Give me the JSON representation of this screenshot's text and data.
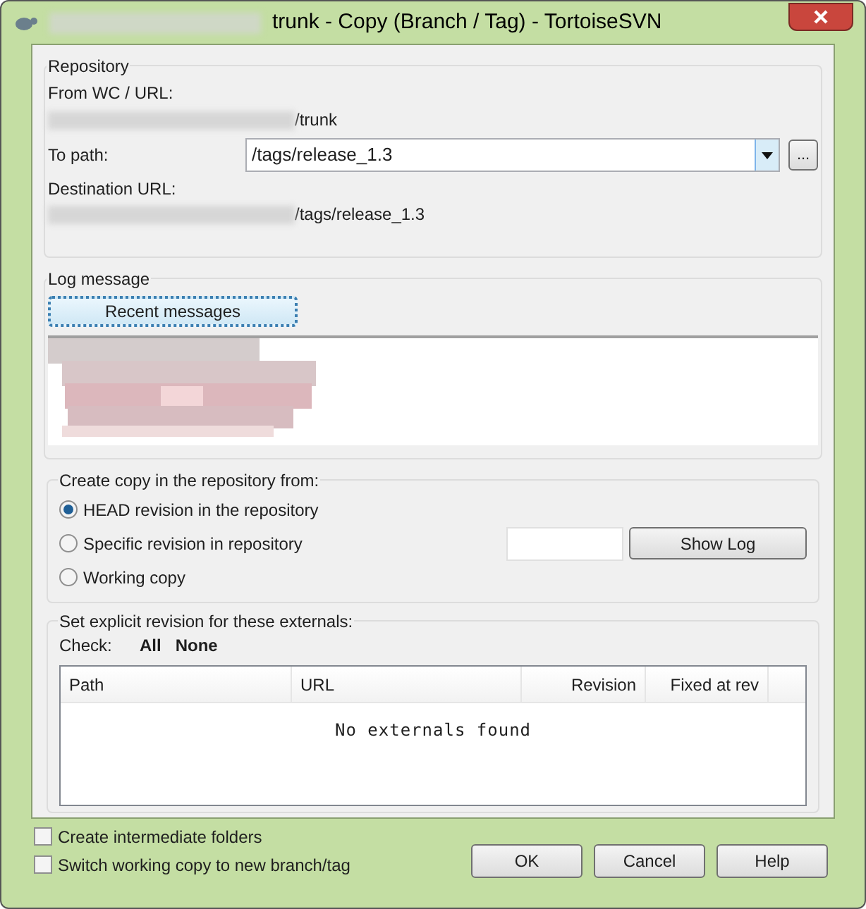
{
  "window": {
    "title": "trunk - Copy (Branch / Tag) - TortoiseSVN"
  },
  "repository": {
    "title": "Repository",
    "from_label": "From WC / URL:",
    "from_value": "/trunk",
    "to_label": "To path:",
    "to_value": "/tags/release_1.3",
    "browse_button": "...",
    "destination_label": "Destination URL:",
    "destination_value": "/tags/release_1.3"
  },
  "log_message": {
    "title": "Log message",
    "recent_button": {
      "label": "Recent messages",
      "focused": true
    }
  },
  "copy_from": {
    "title": "Create copy in the repository from:",
    "options": [
      {
        "label": "HEAD revision in the repository",
        "selected": true
      },
      {
        "label": "Specific revision in repository",
        "selected": false
      },
      {
        "label": "Working copy",
        "selected": false
      }
    ],
    "show_log_button": "Show Log"
  },
  "externals": {
    "title": "Set explicit revision for these externals:",
    "check_label": "Check:",
    "check_links": [
      "All",
      "None"
    ],
    "columns": [
      "Path",
      "URL",
      "Revision",
      "Fixed at rev"
    ],
    "empty_text": "No externals found"
  },
  "options": [
    {
      "label": "Create intermediate folders",
      "checked": false
    },
    {
      "label": "Switch working copy to new branch/tag",
      "checked": false
    }
  ],
  "buttons": [
    "OK",
    "Cancel",
    "Help"
  ]
}
